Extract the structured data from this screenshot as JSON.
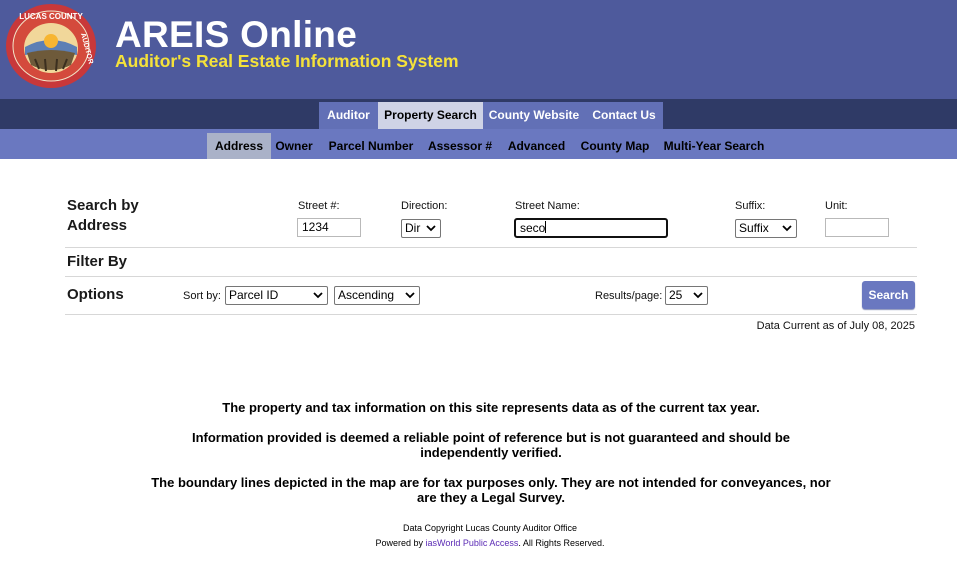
{
  "header": {
    "logo_text": "LUCAS COUNTY AUDITOR",
    "title": "AREIS Online",
    "subtitle": "Auditor's Real Estate Information System"
  },
  "top_nav": {
    "tabs": [
      {
        "label": "Auditor",
        "active": false
      },
      {
        "label": "Property Search",
        "active": true
      },
      {
        "label": "County Website",
        "active": false
      },
      {
        "label": "Contact Us",
        "active": false
      }
    ]
  },
  "sub_nav": {
    "tabs": [
      {
        "label": "Address",
        "active": true
      },
      {
        "label": "Owner",
        "active": false
      },
      {
        "label": "Parcel Number",
        "active": false
      },
      {
        "label": "Assessor #",
        "active": false
      },
      {
        "label": "Advanced",
        "active": false
      },
      {
        "label": "County Map",
        "active": false
      },
      {
        "label": "Multi-Year Search",
        "active": false
      }
    ]
  },
  "search": {
    "heading_line1": "Search by",
    "heading_line2": "Address",
    "street_num": {
      "label": "Street #:",
      "value": "1234"
    },
    "direction": {
      "label": "Direction:",
      "value": "Dir"
    },
    "street_name": {
      "label": "Street Name:",
      "value": "seco"
    },
    "suffix": {
      "label": "Suffix:",
      "value": "Suffix"
    },
    "unit": {
      "label": "Unit:",
      "value": ""
    }
  },
  "filter": {
    "heading": "Filter By"
  },
  "options": {
    "heading": "Options",
    "sort_label": "Sort by:",
    "sort_field": "Parcel ID",
    "sort_order": "Ascending",
    "results_label": "Results/page:",
    "results_value": "25",
    "search_button": "Search"
  },
  "data_current": "Data Current as of July 08, 2025",
  "notice": {
    "line1": "The property and tax information on this site represents data as of the current tax year.",
    "line2": "Information provided is deemed a reliable point of reference but is not guaranteed and should be independently verified.",
    "line3": "The boundary lines depicted in the map are for tax purposes only. They are not intended for conveyances, nor are they a Legal Survey."
  },
  "footer": {
    "copyright": "Data Copyright Lucas County Auditor Office",
    "powered_prefix": "Powered by ",
    "powered_link": "iasWorld Public Access",
    "powered_suffix": ". All Rights Reserved."
  },
  "colors": {
    "header_bg": "#4e5a9c",
    "subtitle_yellow": "#f5e23a",
    "nav_dark": "#2f3a66",
    "nav_tab": "#6270b6",
    "subnav_bg": "#6a78c0",
    "link_purple": "#5b2bb5"
  }
}
